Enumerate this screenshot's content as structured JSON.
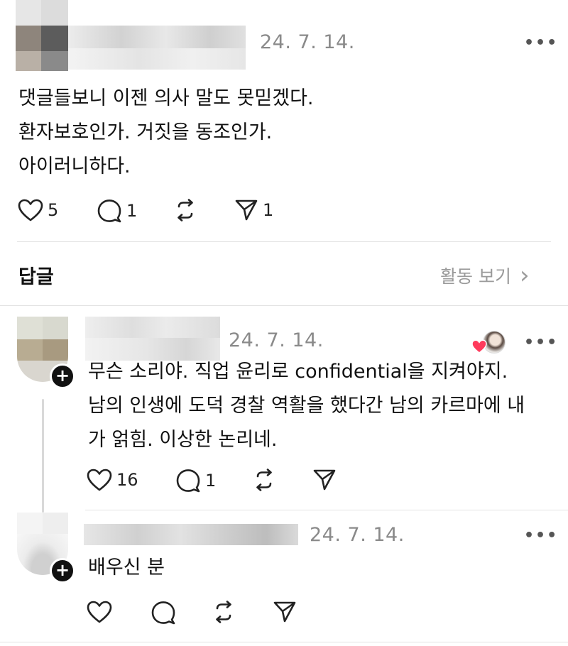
{
  "main_post": {
    "date": "24. 7. 14.",
    "lines": [
      "댓글들보니 이젠 의사 말도 못믿겠다.",
      "환자보호인가.  거짓을 동조인가.",
      "아이러니하다."
    ],
    "likes": "5",
    "replies": "1",
    "shares": "1"
  },
  "replies_section": {
    "title": "답글",
    "activity_link": "활동 보기"
  },
  "reply1": {
    "date": "24. 7. 14.",
    "lines": [
      "무슨 소리야. 직업 윤리로 confidential을 지켜야지.",
      "남의 인생에 도덕 경찰 역활을 했다간 남의 카르마에 내",
      "가 얽힘. 이상한 논리네."
    ],
    "likes": "16",
    "replies": "1"
  },
  "reply2": {
    "date": "24. 7. 14.",
    "lines": [
      "배우신 분"
    ]
  },
  "more_symbol": "•••",
  "plus_symbol": "+",
  "chevron_symbol": "›",
  "colors": {
    "heart_red": "#ff3b5c",
    "muted_text": "#8a8a8a",
    "divider": "#e3e3e3"
  }
}
